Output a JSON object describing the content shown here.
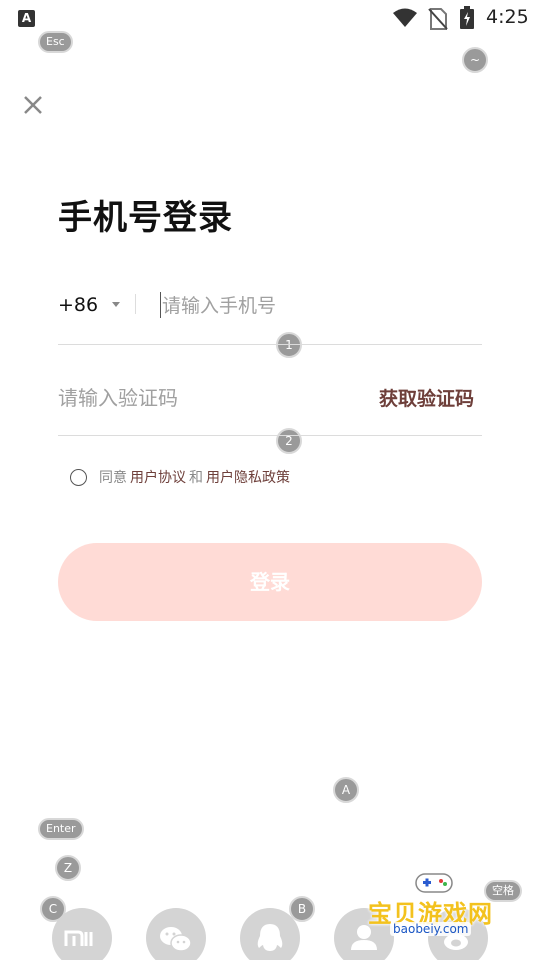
{
  "status_bar": {
    "app_icon": "A",
    "time": "4:25"
  },
  "overlay_keys": {
    "esc": "Esc",
    "tilde": "~",
    "key1": "1",
    "key2": "2",
    "keyA": "A",
    "enter": "Enter",
    "keyZ": "Z",
    "keyC": "C",
    "keyB": "B",
    "space": "空格"
  },
  "title": "手机号登录",
  "phone": {
    "country_code": "+86",
    "placeholder": "请输入手机号",
    "value": ""
  },
  "code": {
    "placeholder": "请输入验证码",
    "value": "",
    "get_code_label": "获取验证码"
  },
  "agreement": {
    "prefix": "同意",
    "user_agreement": "用户协议",
    "and": "和",
    "privacy_policy": "用户隐私政策",
    "checked": false
  },
  "login_button": "登录",
  "colors": {
    "accent": "#6e3f3a",
    "login_button_bg": "#ffdbd6",
    "social_icon_bg": "#d4d4d4"
  },
  "social": [
    {
      "icon": "xiaomi-icon"
    },
    {
      "icon": "wechat-icon"
    },
    {
      "icon": "qq-icon"
    },
    {
      "icon": "account-icon"
    },
    {
      "icon": "weibo-icon"
    }
  ],
  "watermark": {
    "title": "宝贝游戏网",
    "url": "baobeiy.com"
  }
}
